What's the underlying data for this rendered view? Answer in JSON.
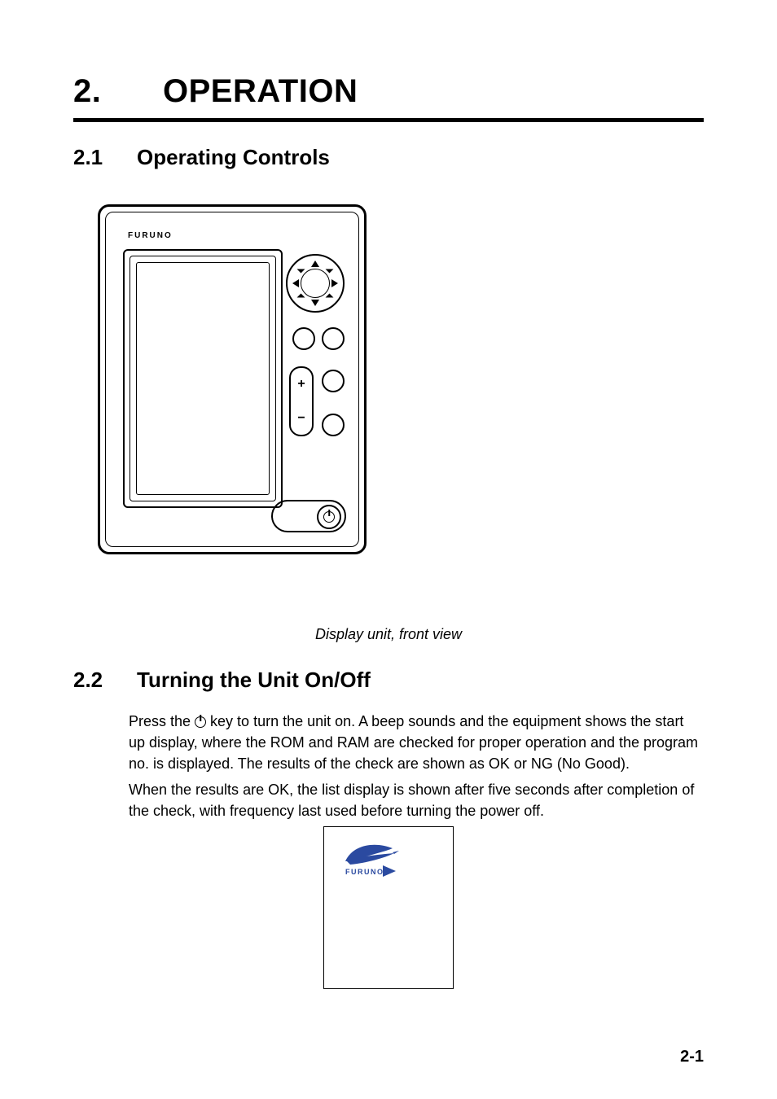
{
  "chapter": {
    "number": "2.",
    "title": "OPERATION"
  },
  "sections": {
    "s1": {
      "number": "2.1",
      "title": "Operating Controls"
    },
    "s2": {
      "number": "2.2",
      "title": "Turning the Unit On/Off"
    }
  },
  "figure1": {
    "brand": "FURUNO",
    "zoom_plus": "+",
    "zoom_minus": "−",
    "caption": "Display unit, front view"
  },
  "body": {
    "p1a": "Press the ",
    "p1b": " key to turn the unit on. A beep sounds and the equipment shows the start up display, where the ROM and RAM are checked for proper operation and the program no. is displayed. The results of the check are shown as OK or NG (No Good).",
    "p2": "When the results are OK, the list display is shown after five seconds after completion of the check, with frequency last used before turning the power off."
  },
  "splash": {
    "brand": "FURUNO"
  },
  "page_number": "2-1"
}
